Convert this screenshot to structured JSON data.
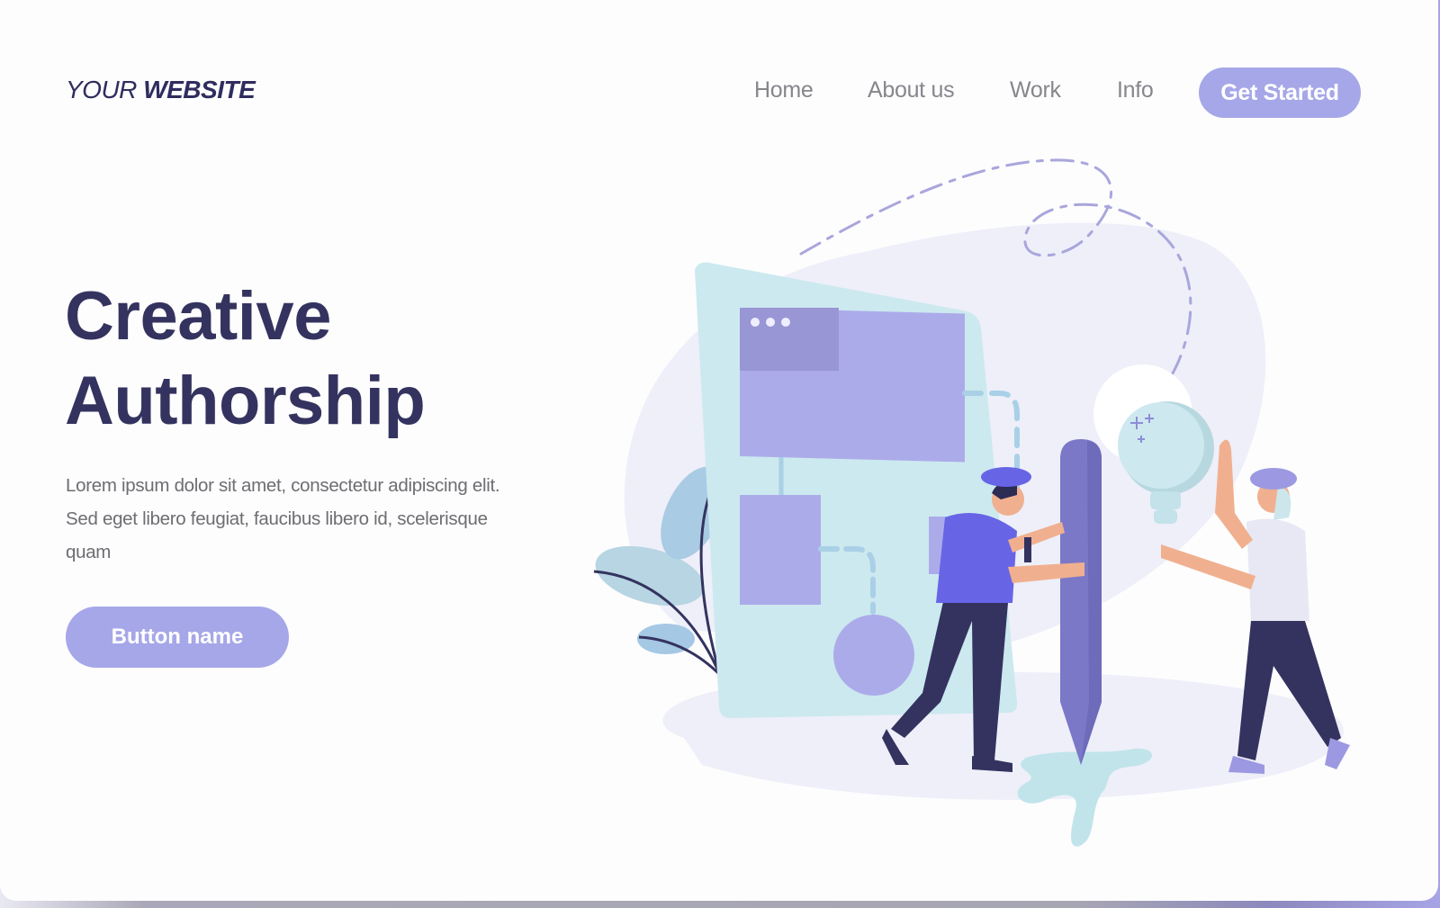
{
  "header": {
    "logo_regular": "YOUR",
    "logo_bold": "WEBSITE",
    "nav": [
      {
        "label": "Home"
      },
      {
        "label": "About us"
      },
      {
        "label": "Work"
      },
      {
        "label": "Info"
      }
    ],
    "cta_label": "Get Started"
  },
  "hero": {
    "title_line1": "Creative",
    "title_line2": "Authorship",
    "description": "Lorem ipsum dolor sit amet, consectetur adipiscing elit. Sed eget libero feugiat, faucibus libero id, scelerisque quam",
    "button_label": "Button name"
  },
  "illustration": {
    "subject": "Two people with a giant pencil and a light bulb in front of a flowchart board",
    "icons": [
      "flowchart-board-icon",
      "pencil-icon",
      "lightbulb-icon",
      "plant-icon",
      "person-icon"
    ]
  },
  "colors": {
    "brand_dark": "#34335f",
    "accent": "#a6a7e8",
    "nav_text": "#86868c",
    "body_text": "#6d6d72",
    "board": "#cde9ef",
    "panel": "#acabea",
    "pencil": "#7b78c8"
  }
}
